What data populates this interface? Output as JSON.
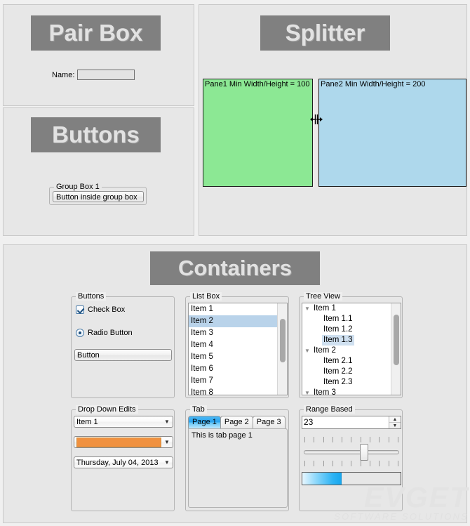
{
  "sections": {
    "pair_box": {
      "title": "Pair Box",
      "name_label": "Name:",
      "name_value": "",
      "name_placeholder": ""
    },
    "buttons": {
      "title": "Buttons",
      "group_box_legend": "Group Box 1",
      "button_label": "Button inside group box"
    },
    "splitter": {
      "title": "Splitter",
      "pane1_text": "Pane1 Min Width/Height = 100",
      "pane2_text": "Pane2 Min Width/Height = 200",
      "pane1_color": "#8ce894",
      "pane2_color": "#aed8ec",
      "grip_icon": "horizontal-resize-cursor"
    },
    "containers": {
      "title": "Containers",
      "buttons_group": {
        "legend": "Buttons",
        "checkbox_label": "Check Box",
        "checkbox_checked": true,
        "radio_label": "Radio Button",
        "radio_selected": true,
        "button_label": "Button"
      },
      "list_box": {
        "legend": "List Box",
        "items": [
          "Item 1",
          "Item 2",
          "Item 3",
          "Item 4",
          "Item 5",
          "Item 6",
          "Item 7",
          "Item 8"
        ],
        "selected_index": 1,
        "selected_color": "#b9d3ea"
      },
      "tree_view": {
        "legend": "Tree View",
        "nodes": [
          {
            "label": "Item 1",
            "level": 0,
            "expanded": true,
            "selected": false
          },
          {
            "label": "Item 1.1",
            "level": 1,
            "expanded": null,
            "selected": false
          },
          {
            "label": "Item 1.2",
            "level": 1,
            "expanded": null,
            "selected": false
          },
          {
            "label": "Item 1.3",
            "level": 1,
            "expanded": null,
            "selected": true
          },
          {
            "label": "Item 2",
            "level": 0,
            "expanded": true,
            "selected": false
          },
          {
            "label": "Item 2.1",
            "level": 1,
            "expanded": null,
            "selected": false
          },
          {
            "label": "Item 2.2",
            "level": 1,
            "expanded": null,
            "selected": false
          },
          {
            "label": "Item 2.3",
            "level": 1,
            "expanded": null,
            "selected": false
          },
          {
            "label": "Item 3",
            "level": 0,
            "expanded": true,
            "selected": false
          }
        ],
        "expand_icon": "triangle-down-icon",
        "selected_color": "#cfe0f0"
      },
      "drop_down_edits": {
        "legend": "Drop Down Edits",
        "combo_item_value": "Item 1",
        "color_combo_value": "#f0913f",
        "date_combo_value": "Thursday, July 04, 2013",
        "arrow_icon": "chevron-down-icon"
      },
      "tab": {
        "legend": "Tab",
        "tabs": [
          "Page 1",
          "Page 2",
          "Page 3"
        ],
        "active_index": 0,
        "body_text": "This is tab page 1",
        "active_color": "#2aa3ee"
      },
      "range_based": {
        "legend": "Range Based",
        "spinner_value": "23",
        "spinner_up_icon": "triangle-up-icon",
        "spinner_down_icon": "triangle-down-icon",
        "slider_tick_count": 11,
        "slider_percent": 63,
        "progress_percent": 40,
        "progress_color": "#2fb4f4"
      }
    }
  },
  "watermark": {
    "main": "EVGET",
    "sub": "SOFTWARE SOLUTIONS"
  }
}
